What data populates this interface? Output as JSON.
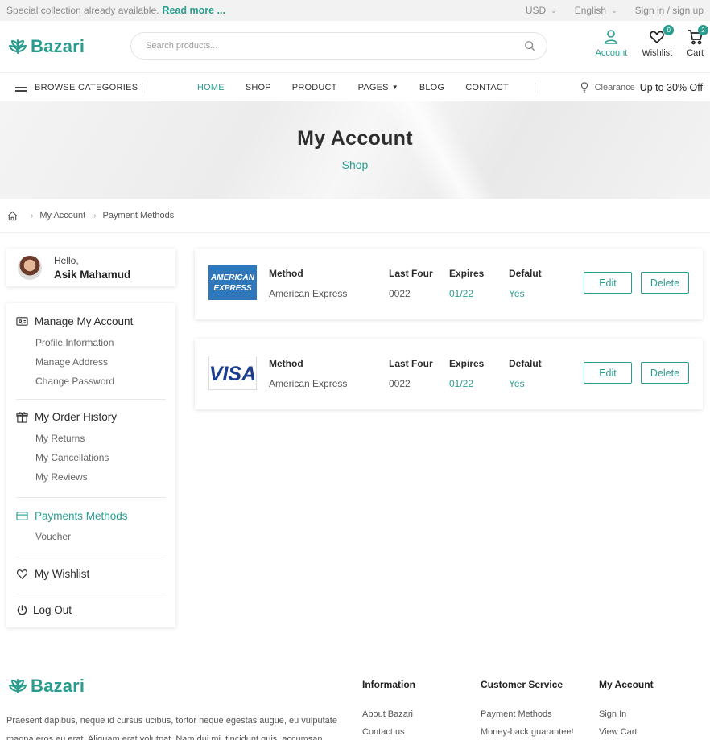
{
  "topbar": {
    "promo_text": "Special collection already available.",
    "promo_link": "Read more ...",
    "currency": "USD",
    "language": "English",
    "auth": "Sign in / sign up"
  },
  "brand": {
    "name": "Bazari",
    "accent": "#2a9d8f"
  },
  "search": {
    "placeholder": "Search products..."
  },
  "header_actions": {
    "account": "Account",
    "wishlist": "Wishlist",
    "wishlist_count": "0",
    "cart": "Cart",
    "cart_count": "2"
  },
  "nav": {
    "browse": "BROWSE CATEGORIES",
    "items": [
      "HOME",
      "SHOP",
      "PRODUCT",
      "PAGES",
      "BLOG",
      "CONTACT"
    ],
    "clearance_label": "Clearance",
    "clearance_value": "Up to 30% Off"
  },
  "hero": {
    "title": "My Account",
    "subtitle": "Shop"
  },
  "breadcrumb": [
    "My Account",
    "Payment Methods"
  ],
  "profile": {
    "greeting": "Hello,",
    "name": "Asik Mahamud"
  },
  "sidebar": {
    "manage": "Manage My Account",
    "manage_items": [
      "Profile Information",
      "Manage Address",
      "Change Password"
    ],
    "orders": "My Order History",
    "order_items": [
      "My Returns",
      "My Cancellations",
      "My Reviews"
    ],
    "payments": "Payments Methods",
    "payment_items": [
      "Voucher"
    ],
    "wishlist": "My Wishlist",
    "logout": "Log Out"
  },
  "payments_header": {
    "method": "Method",
    "last_four": "Last Four",
    "expires": "Expires",
    "default": "Defalut"
  },
  "payments": [
    {
      "logo_line1": "AMERICAN",
      "logo_line2": "EXPRESS",
      "method": "American Express",
      "last_four": "0022",
      "expires": "01/22",
      "default": "Yes",
      "edit": "Edit",
      "delete": "Delete"
    },
    {
      "logo_text": "VISA",
      "method": "American Express",
      "last_four": "0022",
      "expires": "01/22",
      "default": "Yes",
      "edit": "Edit",
      "delete": "Delete"
    }
  ],
  "footer": {
    "description": "Praesent dapibus, neque id cursus ucibus, tortor neque egestas augue, eu vulputate magna eros eu erat. Aliquam erat volutpat. Nam dui mi, tincidunt quis, accumsan",
    "information": {
      "title": "Information",
      "links": [
        "About Bazari",
        "Contact us"
      ]
    },
    "customer_service": {
      "title": "Customer Service",
      "links": [
        "Payment Methods",
        "Money-back guarantee!"
      ]
    },
    "my_account": {
      "title": "My Account",
      "links": [
        "Sign In",
        "View Cart"
      ]
    }
  }
}
